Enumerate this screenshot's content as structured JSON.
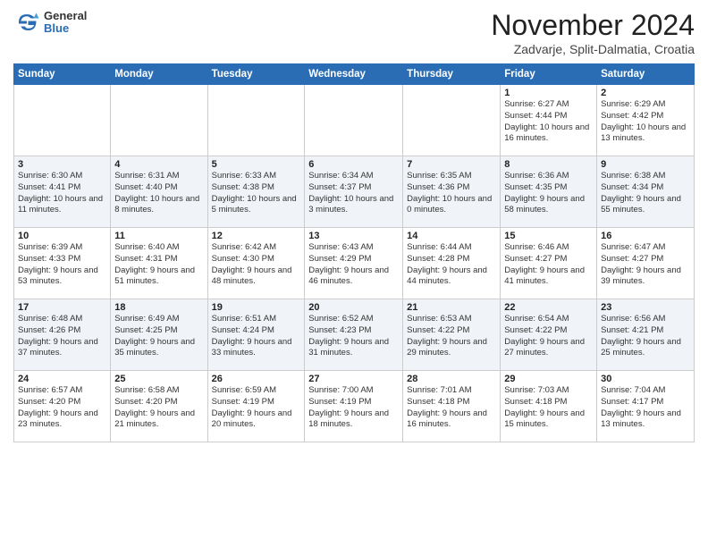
{
  "header": {
    "logo_general": "General",
    "logo_blue": "Blue",
    "month_title": "November 2024",
    "location": "Zadvarje, Split-Dalmatia, Croatia"
  },
  "days_of_week": [
    "Sunday",
    "Monday",
    "Tuesday",
    "Wednesday",
    "Thursday",
    "Friday",
    "Saturday"
  ],
  "weeks": [
    [
      {
        "day": "",
        "info": ""
      },
      {
        "day": "",
        "info": ""
      },
      {
        "day": "",
        "info": ""
      },
      {
        "day": "",
        "info": ""
      },
      {
        "day": "",
        "info": ""
      },
      {
        "day": "1",
        "info": "Sunrise: 6:27 AM\nSunset: 4:44 PM\nDaylight: 10 hours and 16 minutes."
      },
      {
        "day": "2",
        "info": "Sunrise: 6:29 AM\nSunset: 4:42 PM\nDaylight: 10 hours and 13 minutes."
      }
    ],
    [
      {
        "day": "3",
        "info": "Sunrise: 6:30 AM\nSunset: 4:41 PM\nDaylight: 10 hours and 11 minutes."
      },
      {
        "day": "4",
        "info": "Sunrise: 6:31 AM\nSunset: 4:40 PM\nDaylight: 10 hours and 8 minutes."
      },
      {
        "day": "5",
        "info": "Sunrise: 6:33 AM\nSunset: 4:38 PM\nDaylight: 10 hours and 5 minutes."
      },
      {
        "day": "6",
        "info": "Sunrise: 6:34 AM\nSunset: 4:37 PM\nDaylight: 10 hours and 3 minutes."
      },
      {
        "day": "7",
        "info": "Sunrise: 6:35 AM\nSunset: 4:36 PM\nDaylight: 10 hours and 0 minutes."
      },
      {
        "day": "8",
        "info": "Sunrise: 6:36 AM\nSunset: 4:35 PM\nDaylight: 9 hours and 58 minutes."
      },
      {
        "day": "9",
        "info": "Sunrise: 6:38 AM\nSunset: 4:34 PM\nDaylight: 9 hours and 55 minutes."
      }
    ],
    [
      {
        "day": "10",
        "info": "Sunrise: 6:39 AM\nSunset: 4:33 PM\nDaylight: 9 hours and 53 minutes."
      },
      {
        "day": "11",
        "info": "Sunrise: 6:40 AM\nSunset: 4:31 PM\nDaylight: 9 hours and 51 minutes."
      },
      {
        "day": "12",
        "info": "Sunrise: 6:42 AM\nSunset: 4:30 PM\nDaylight: 9 hours and 48 minutes."
      },
      {
        "day": "13",
        "info": "Sunrise: 6:43 AM\nSunset: 4:29 PM\nDaylight: 9 hours and 46 minutes."
      },
      {
        "day": "14",
        "info": "Sunrise: 6:44 AM\nSunset: 4:28 PM\nDaylight: 9 hours and 44 minutes."
      },
      {
        "day": "15",
        "info": "Sunrise: 6:46 AM\nSunset: 4:27 PM\nDaylight: 9 hours and 41 minutes."
      },
      {
        "day": "16",
        "info": "Sunrise: 6:47 AM\nSunset: 4:27 PM\nDaylight: 9 hours and 39 minutes."
      }
    ],
    [
      {
        "day": "17",
        "info": "Sunrise: 6:48 AM\nSunset: 4:26 PM\nDaylight: 9 hours and 37 minutes."
      },
      {
        "day": "18",
        "info": "Sunrise: 6:49 AM\nSunset: 4:25 PM\nDaylight: 9 hours and 35 minutes."
      },
      {
        "day": "19",
        "info": "Sunrise: 6:51 AM\nSunset: 4:24 PM\nDaylight: 9 hours and 33 minutes."
      },
      {
        "day": "20",
        "info": "Sunrise: 6:52 AM\nSunset: 4:23 PM\nDaylight: 9 hours and 31 minutes."
      },
      {
        "day": "21",
        "info": "Sunrise: 6:53 AM\nSunset: 4:22 PM\nDaylight: 9 hours and 29 minutes."
      },
      {
        "day": "22",
        "info": "Sunrise: 6:54 AM\nSunset: 4:22 PM\nDaylight: 9 hours and 27 minutes."
      },
      {
        "day": "23",
        "info": "Sunrise: 6:56 AM\nSunset: 4:21 PM\nDaylight: 9 hours and 25 minutes."
      }
    ],
    [
      {
        "day": "24",
        "info": "Sunrise: 6:57 AM\nSunset: 4:20 PM\nDaylight: 9 hours and 23 minutes."
      },
      {
        "day": "25",
        "info": "Sunrise: 6:58 AM\nSunset: 4:20 PM\nDaylight: 9 hours and 21 minutes."
      },
      {
        "day": "26",
        "info": "Sunrise: 6:59 AM\nSunset: 4:19 PM\nDaylight: 9 hours and 20 minutes."
      },
      {
        "day": "27",
        "info": "Sunrise: 7:00 AM\nSunset: 4:19 PM\nDaylight: 9 hours and 18 minutes."
      },
      {
        "day": "28",
        "info": "Sunrise: 7:01 AM\nSunset: 4:18 PM\nDaylight: 9 hours and 16 minutes."
      },
      {
        "day": "29",
        "info": "Sunrise: 7:03 AM\nSunset: 4:18 PM\nDaylight: 9 hours and 15 minutes."
      },
      {
        "day": "30",
        "info": "Sunrise: 7:04 AM\nSunset: 4:17 PM\nDaylight: 9 hours and 13 minutes."
      }
    ]
  ]
}
